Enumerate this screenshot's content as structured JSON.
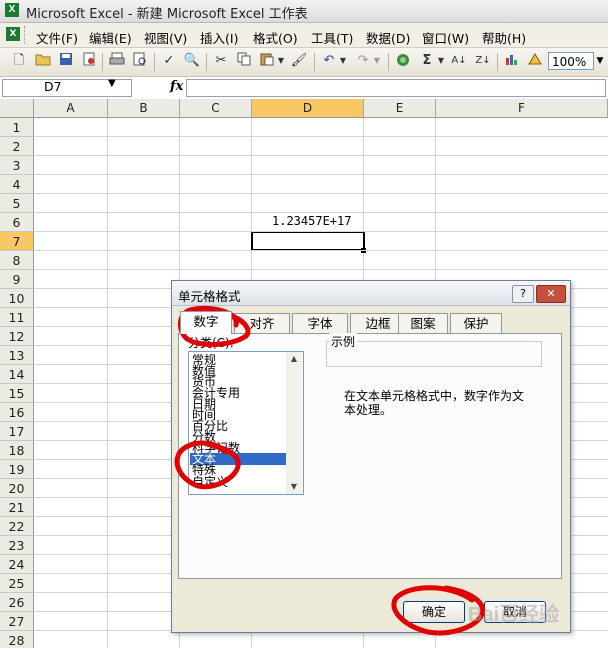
{
  "window": {
    "title": "Microsoft Excel - 新建 Microsoft Excel 工作表",
    "app_icon": "X"
  },
  "menu": {
    "items": [
      "文件(F)",
      "编辑(E)",
      "视图(V)",
      "插入(I)",
      "格式(O)",
      "工具(T)",
      "数据(D)",
      "窗口(W)",
      "帮助(H)"
    ]
  },
  "toolbar": {
    "icons": [
      "new-icon",
      "open-icon",
      "save-icon",
      "permission-icon",
      "print-icon",
      "print-preview-icon",
      "spelling-icon",
      "research-icon",
      "cut-icon",
      "copy-icon",
      "paste-icon",
      "format-painter-icon",
      "undo-icon",
      "redo-icon",
      "hyperlink-icon",
      "autosum-icon",
      "sort-ascending-icon",
      "sort-descending-icon",
      "chart-wizard-icon",
      "drawing-icon"
    ],
    "zoom": "100%"
  },
  "formula_bar": {
    "name_box": "D7",
    "fx_label": "fx",
    "formula": ""
  },
  "sheet": {
    "columns": [
      "A",
      "B",
      "C",
      "D",
      "E",
      "F"
    ],
    "selected_column": "D",
    "rows": [
      "1",
      "2",
      "3",
      "4",
      "5",
      "6",
      "7",
      "8",
      "9",
      "10",
      "11",
      "12",
      "13",
      "14",
      "15",
      "16",
      "17",
      "18",
      "19",
      "20",
      "21",
      "22",
      "23",
      "24",
      "25",
      "26",
      "27",
      "28"
    ],
    "selected_row": "7",
    "cells": {
      "D6": "1.23457E+17"
    },
    "active_cell": "D7"
  },
  "dialog": {
    "title": "单元格格式",
    "help_button": "?",
    "close_button": "✕",
    "tabs": [
      "数字",
      "对齐",
      "字体",
      "边框",
      "图案",
      "保护"
    ],
    "active_tab": "数字",
    "category_label": "分类(C):",
    "categories": [
      "常规",
      "数值",
      "货币",
      "会计专用",
      "日期",
      "时间",
      "百分比",
      "分数",
      "科学记数",
      "文本",
      "特殊",
      "自定义"
    ],
    "selected_category": "文本",
    "sample_label": "示例",
    "description": "在文本单元格格式中，数字作为文本处理。",
    "ok_label": "确定",
    "cancel_label": "取消"
  },
  "annotation_color": "#e00000",
  "watermark": "Bai百经验"
}
